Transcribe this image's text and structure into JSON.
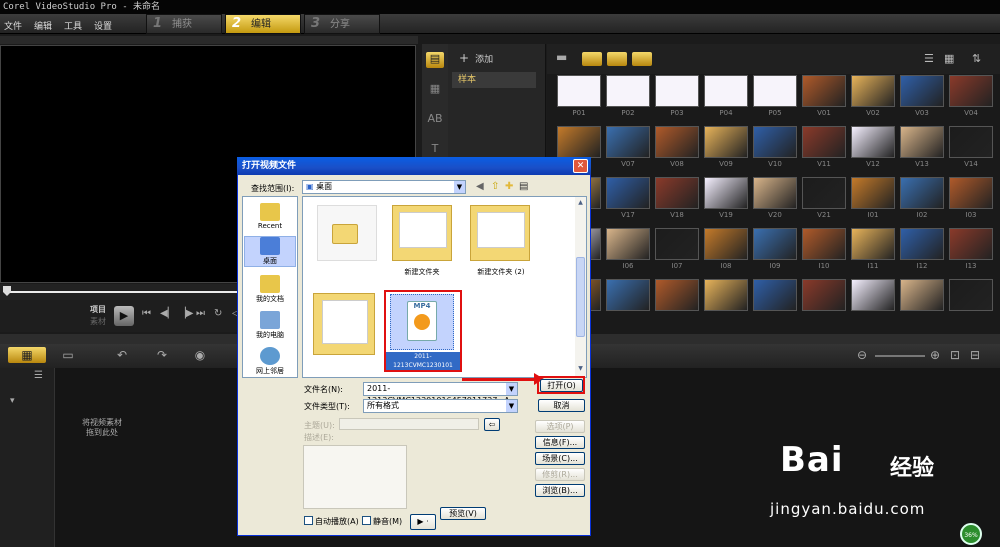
{
  "window": {
    "title": "Corel VideoStudio Pro - 未命名"
  },
  "menu": [
    "文件",
    "编辑",
    "工具",
    "设置"
  ],
  "steps": [
    {
      "num": "1",
      "label": "捕获",
      "active": false
    },
    {
      "num": "2",
      "label": "编辑",
      "active": true
    },
    {
      "num": "3",
      "label": "分享",
      "active": false
    }
  ],
  "preview": {
    "project_label": "项目",
    "clip_label": "素材"
  },
  "library": {
    "add_label": "添加",
    "category_selected": "样本",
    "thumbnails": [
      [
        "P01",
        "P02",
        "P03",
        "P04",
        "P05",
        "V01",
        "V02",
        "V03",
        "V04"
      ],
      [
        "",
        "V07",
        "V08",
        "V09",
        "V10",
        "V11",
        "V12",
        "V13",
        "V14"
      ],
      [
        "",
        "V17",
        "V18",
        "V19",
        "V20",
        "V21",
        "I01",
        "I02",
        "I03"
      ],
      [
        "",
        "I06",
        "I07",
        "I08",
        "I09",
        "I10",
        "I11",
        "I12",
        "I13"
      ],
      [
        "",
        "",
        "",
        "",
        "",
        "",
        "",
        "",
        ""
      ]
    ]
  },
  "timeline": {
    "hint": "将视频素材拖到此处"
  },
  "dialog": {
    "title": "打开视频文件",
    "lookin_label": "查找范围(I):",
    "lookin_value": "桌面",
    "places": [
      "Recent",
      "桌面",
      "我的文档",
      "我的电脑",
      "网上邻居"
    ],
    "files": [
      {
        "name": "",
        "type": "folder"
      },
      {
        "name": "新建文件夹",
        "type": "folder"
      },
      {
        "name": "新建文件夹 (2)",
        "type": "folder"
      },
      {
        "name": "",
        "type": "folder"
      },
      {
        "name": "2011-1213CVMC1230101",
        "type": "mp4",
        "selected": true
      }
    ],
    "filename_label": "文件名(N):",
    "filename_value": "2011-1213CVMC12301016457911727~A",
    "filetype_label": "文件类型(T):",
    "filetype_value": "所有格式",
    "subject_label": "主题(U):",
    "description_label": "描述(E):",
    "buttons": {
      "open": "打开(O)",
      "cancel": "取消",
      "options": "选项(P)",
      "info": "信息(F)...",
      "scene": "场景(C)...",
      "crop": "修剪(R)...",
      "browse": "浏览(B)..."
    },
    "autoplay_label": "自动播放(A)",
    "mute_label": "静音(M)",
    "preview_button": "预览(V)",
    "play_glyph": "▶ ·"
  },
  "watermark": {
    "logo": "Bai",
    "logo_cn": "经验",
    "url": "jingyan.baidu.com"
  },
  "status": {
    "speed": "36%"
  }
}
